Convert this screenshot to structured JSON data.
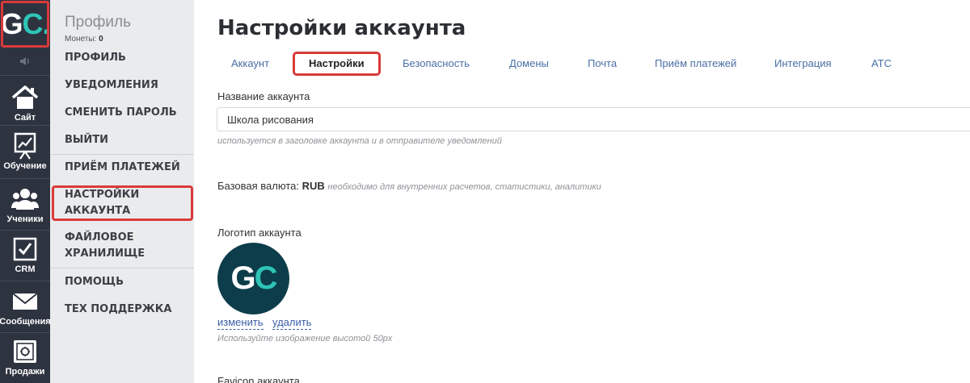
{
  "rail": {
    "logo": {
      "g": "G",
      "c": "C",
      "dot": "."
    },
    "items": [
      {
        "label": "Сайт",
        "icon": "house-icon"
      },
      {
        "label": "Обучение",
        "icon": "chart-board-icon"
      },
      {
        "label": "Ученики",
        "icon": "users-icon"
      },
      {
        "label": "CRM",
        "icon": "checkbox-icon"
      },
      {
        "label": "Сообщения",
        "icon": "envelope-icon"
      },
      {
        "label": "Продажи",
        "icon": "safe-icon"
      }
    ]
  },
  "sidebar": {
    "title": "Профиль",
    "coins_label": "Монеты:",
    "coins_value": "0",
    "items": [
      {
        "label": "ПРОФИЛЬ"
      },
      {
        "label": "УВЕДОМЛЕНИЯ"
      },
      {
        "label": "СМЕНИТЬ ПАРОЛЬ"
      },
      {
        "label": "ВЫЙТИ"
      },
      {
        "label": "ПРИЁМ ПЛАТЕЖЕЙ"
      },
      {
        "label": "НАСТРОЙКИ АККАУНТА"
      },
      {
        "label": "ФАЙЛОВОЕ ХРАНИЛИЩЕ"
      },
      {
        "label": "ПОМОЩЬ"
      },
      {
        "label": "ТЕХ ПОДДЕРЖКА"
      }
    ]
  },
  "main": {
    "title": "Настройки аккаунта",
    "tabs": [
      {
        "label": "Аккаунт"
      },
      {
        "label": "Настройки",
        "active": true
      },
      {
        "label": "Безопасность"
      },
      {
        "label": "Домены"
      },
      {
        "label": "Почта"
      },
      {
        "label": "Приём платежей"
      },
      {
        "label": "Интеграция"
      },
      {
        "label": "АТС"
      }
    ],
    "account_name": {
      "label": "Название аккаунта",
      "value": "Школа рисования",
      "hint": "используется в заголовке аккаунта и в отправителе уведомлений"
    },
    "currency": {
      "label": "Базовая валюта:",
      "value": "RUB",
      "hint": "необходимо для внутренних расчетов, статистики, аналитики"
    },
    "logo": {
      "label": "Логотип аккаунта",
      "g": "G",
      "c": "C",
      "change": "изменить",
      "delete": "удалить",
      "hint": "Используйте изображение высотой 50px"
    },
    "favicon": {
      "label": "Favicon аккаунта"
    }
  },
  "colors": {
    "rail_bg": "#2e3340",
    "sidebar_bg": "#eaebed",
    "highlight": "#d93a3a",
    "logo_bg": "#0d3d4a",
    "logo_accent": "#2ec4b6",
    "tab_link": "#4a6fa5"
  }
}
